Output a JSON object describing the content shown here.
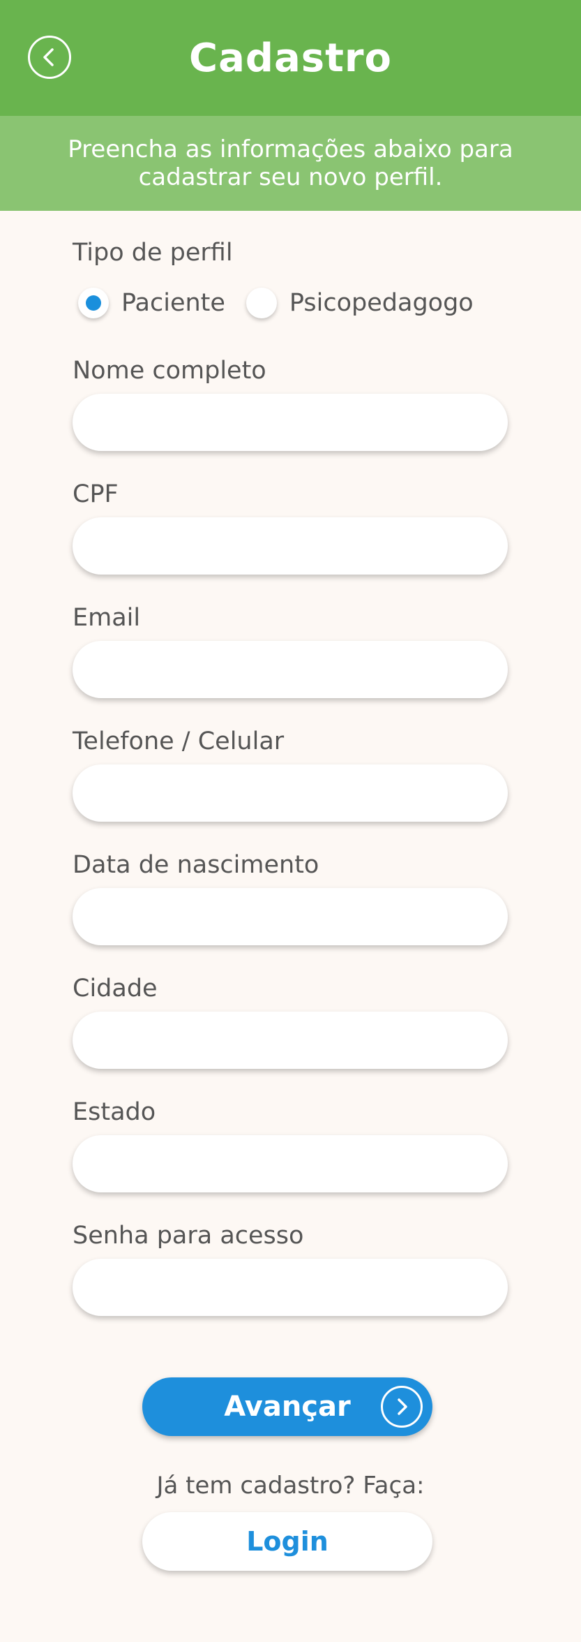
{
  "header": {
    "title": "Cadastro",
    "back_icon": "chevron-left-icon",
    "background_color": "#69b44e"
  },
  "subheader": {
    "text": "Preencha as informações abaixo para cadastrar seu novo perfil.",
    "background_color": "#8ac472"
  },
  "profile_type": {
    "label": "Tipo de perfil",
    "options": [
      {
        "label": "Paciente",
        "selected": true
      },
      {
        "label": "Psicopedagogo",
        "selected": false
      }
    ]
  },
  "fields": [
    {
      "label": "Nome completo",
      "value": ""
    },
    {
      "label": "CPF",
      "value": ""
    },
    {
      "label": "Email",
      "value": ""
    },
    {
      "label": "Telefone / Celular",
      "value": ""
    },
    {
      "label": "Data de nascimento",
      "value": ""
    },
    {
      "label": "Cidade",
      "value": ""
    },
    {
      "label": "Estado",
      "value": ""
    },
    {
      "label": "Senha para acesso",
      "value": ""
    }
  ],
  "actions": {
    "next_label": "Avançar",
    "next_icon": "chevron-right-icon",
    "login_prompt": "Já tem cadastro? Faça:",
    "login_label": "Login",
    "accent_color": "#1e8fdc"
  }
}
